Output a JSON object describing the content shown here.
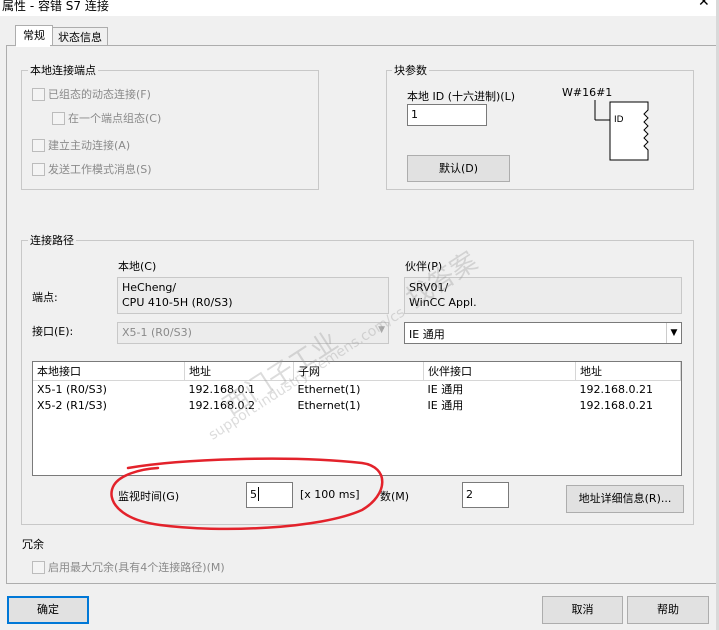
{
  "window": {
    "title": "属性 - 容错 S7 连接"
  },
  "tabs": [
    {
      "label": "常规"
    },
    {
      "label": "状态信息"
    }
  ],
  "local_endpoint": {
    "group_label": "本地连接端点",
    "option_configured_dynamic": "已组态的动态连接(F)",
    "option_one_endpoint": "在一个端点组态(C)",
    "option_active_setup": "建立主动连接(A)",
    "option_send_opmode": "发送工作模式消息(S)"
  },
  "block_params": {
    "group_label": "块参数",
    "local_id_label": "本地 ID (十六进制)(L)",
    "local_id_value": "1",
    "default_button": "默认(D)",
    "block_title": "W#16#1",
    "block_pin": "ID"
  },
  "path": {
    "group_label": "连接路径",
    "local_header": "本地(C)",
    "partner_header": "伙伴(P)",
    "endpoint_label": "端点:",
    "local_endpoint_text": [
      "HeCheng/",
      "CPU 410-5H (R0/S3)"
    ],
    "partner_endpoint_text": [
      "SRV01/",
      "WinCC Appl."
    ],
    "interface_label": "接口(E):",
    "local_interface": "X5-1 (R0/S3)",
    "partner_interface": "IE 通用",
    "table": {
      "columns": [
        "本地接口",
        "地址",
        "子网",
        "伙伴接口",
        "地址"
      ],
      "rows": [
        [
          "X5-1 (R0/S3)",
          "192.168.0.1",
          "Ethernet(1)",
          "IE 通用",
          "192.168.0.21"
        ],
        [
          "X5-2 (R1/S3)",
          "192.168.0.2",
          "Ethernet(1)",
          "IE 通用",
          "192.168.0.21"
        ]
      ]
    },
    "monitor_label": "监视时间(G)",
    "monitor_value": "5",
    "monitor_unit": "[x 100 ms]",
    "count_label": "乘数(M)",
    "count_value": "2",
    "addr_details_button": "地址详细信息(R)..."
  },
  "redundancy": {
    "group_label": "冗余",
    "option_max": "启用最大冗余(具有4个连接路径)(M)"
  },
  "footer": {
    "ok": "确定",
    "cancel": "取消",
    "help": "帮助"
  },
  "watermark": {
    "line1": "西门子工业",
    "line2": "support.industry.siemens.com/cs",
    "line3": "找答案"
  },
  "colors": {
    "annotation_red": "#e3222b",
    "accent": "#0078d7"
  }
}
